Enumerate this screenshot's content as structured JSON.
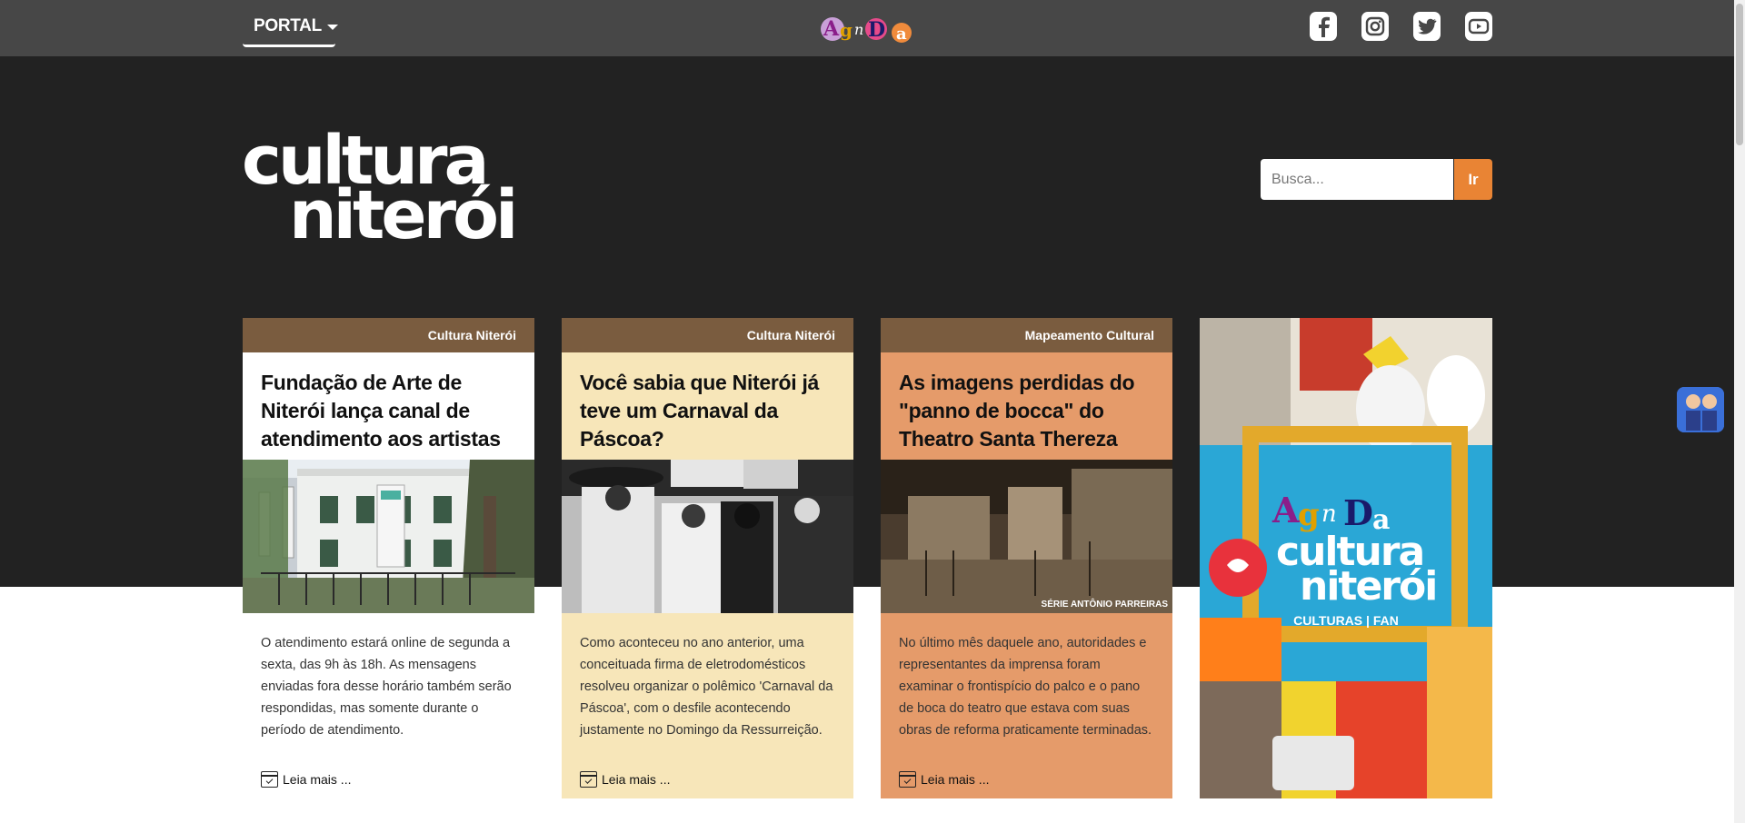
{
  "topbar": {
    "portal_label": "PORTAL",
    "agenda_logo_letters": [
      "A",
      "g",
      "n",
      "D",
      "a"
    ],
    "social_icons": [
      "facebook-icon",
      "instagram-icon",
      "twitter-icon",
      "youtube-icon"
    ]
  },
  "hero": {
    "logo_line1": "cultura",
    "logo_line2": "niterói"
  },
  "search": {
    "placeholder": "Busca...",
    "button_label": "Ir"
  },
  "cards": [
    {
      "category": "Cultura Niterói",
      "title": "Fundação de Arte de Niterói lança canal de atendimento aos artistas",
      "excerpt": "O atendimento estará online de segunda a sexta, das 9h às 18h. As mensagens enviadas fora desse horário também serão respondidas, mas somente durante o período de atendimento.",
      "read_more": "Leia mais ...",
      "bg": "#ffffff"
    },
    {
      "category": "Cultura Niterói",
      "title": "Você sabia que Niterói já teve um Carnaval da Páscoa?",
      "excerpt": "Como aconteceu no ano anterior, uma conceituada firma de eletrodomésticos resolveu organizar o polêmico 'Carnaval da Páscoa', com o desfile acontecendo justamente no Domingo da Ressurreição.",
      "read_more": "Leia mais ...",
      "bg": "#f7e6b9"
    },
    {
      "category": "Mapeamento Cultural",
      "title": "As imagens perdidas do \"panno de bocca\" do Theatro Santa Thereza",
      "excerpt": "No último mês daquele ano, autoridades e representantes da imprensa foram examinar o frontispício do palco e o pano de boca do teatro que estava com suas obras de reforma praticamente terminadas.",
      "read_more": "Leia mais ...",
      "photo_caption": "SÉRIE ANTÔNIO PARREIRAS",
      "bg": "#e59b6a"
    }
  ],
  "promo": {
    "agenda_letters": [
      "A",
      "g",
      "n",
      "D",
      "a"
    ],
    "line1": "cultura",
    "line2": "niterói",
    "subtitle": "CULTURAS | FAN"
  },
  "colors": {
    "topbar": "#474747",
    "hero": "#222222",
    "accent": "#e98434",
    "category_bar": "#7a5c3f"
  }
}
